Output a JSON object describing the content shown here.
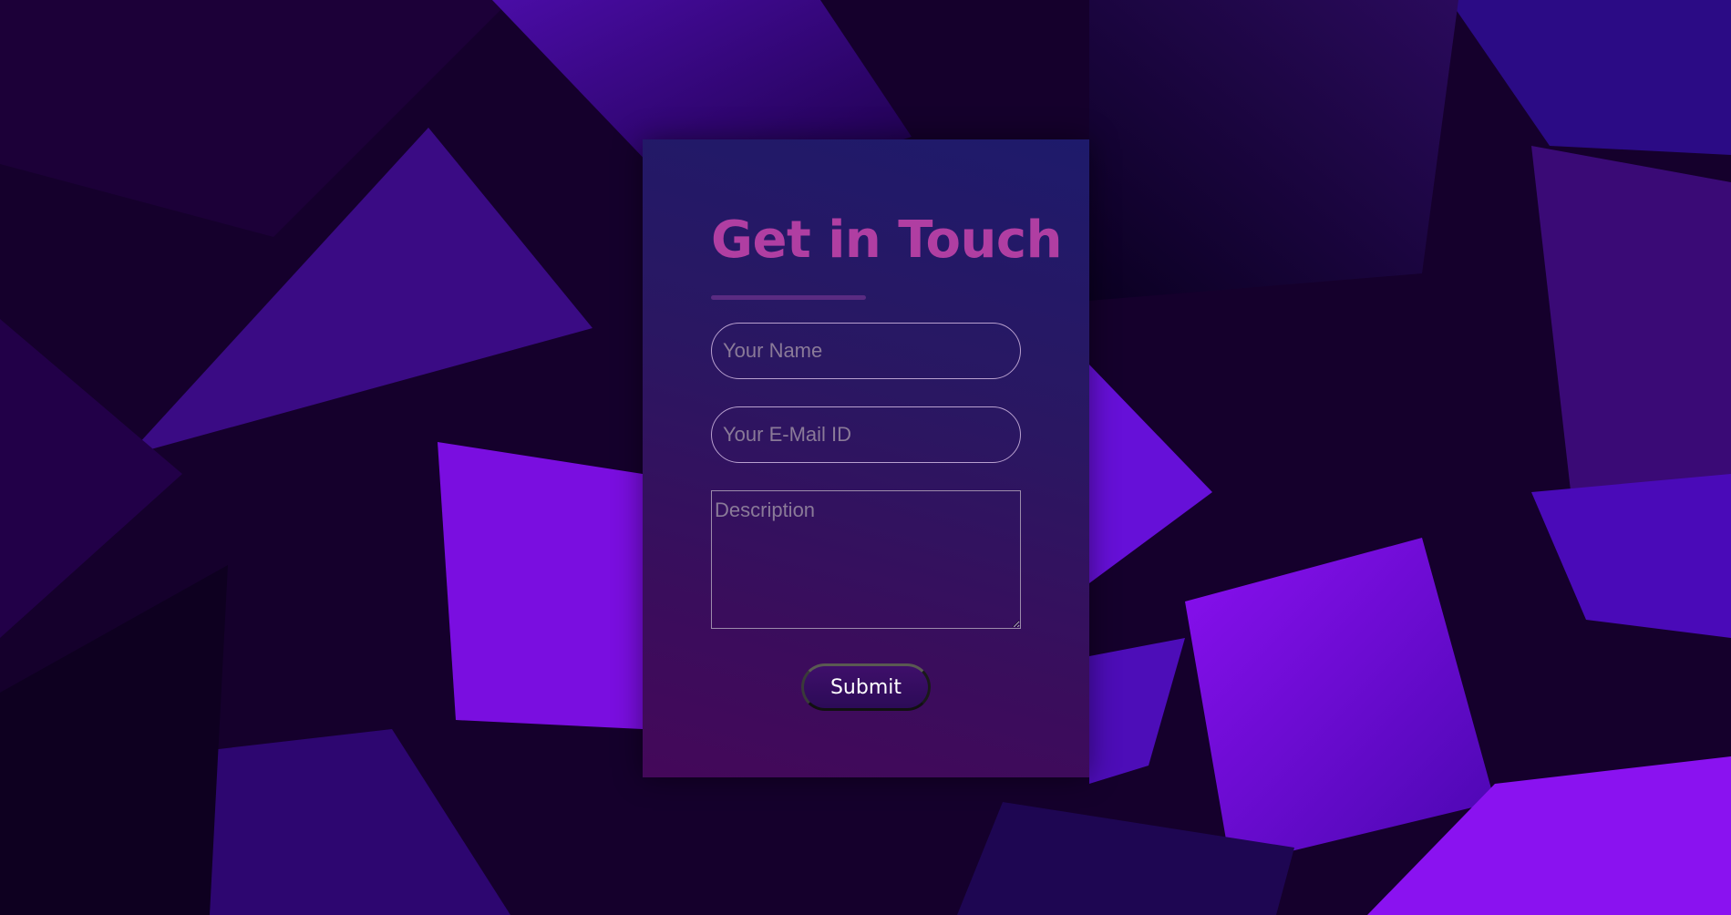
{
  "form": {
    "title": "Get in Touch",
    "name_placeholder": "Your Name",
    "email_placeholder": "Your E-Mail ID",
    "description_placeholder": "Description",
    "submit_label": "Submit"
  },
  "colors": {
    "title": "#b03ea2",
    "accent_underline": "#5a2b82",
    "button_bg": "#2c0b57",
    "background_base": "#16002e"
  }
}
